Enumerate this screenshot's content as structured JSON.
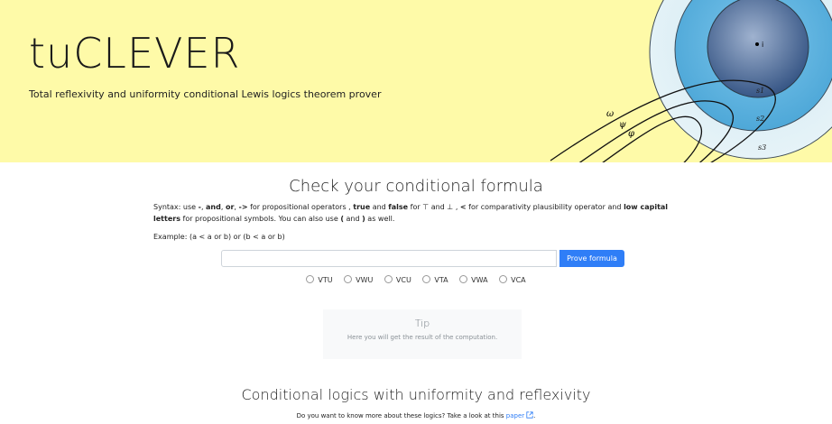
{
  "hero": {
    "title": "tuCLEVER",
    "subtitle": "Total reflexivity and uniformity conditional Lewis logics theorem prover",
    "diagram_labels": {
      "world": "i",
      "sphere1": "s1",
      "sphere2": "s2",
      "sphere3": "s3",
      "omega": "ω",
      "psi": "ψ",
      "phi": "φ"
    }
  },
  "check": {
    "title": "Check your conditional formula",
    "syntax": {
      "p1": "Syntax: use ",
      "k1": "-",
      "p2": ", ",
      "k2": "and",
      "p3": ", ",
      "k3": "or",
      "p4": ", ",
      "k4": "->",
      "p5": " for propositional operators , ",
      "k5": "true",
      "p6": " and ",
      "k6": "false",
      "p7": " for ⊤ and ⊥ , ",
      "k7": "<",
      "p8": " for comparativity plausibility operator and ",
      "k8": "low capital letters",
      "p9": " for propositional symbols. You can also use ",
      "k9": "(",
      "p10": " and ",
      "k10": ")",
      "p11": " as well."
    },
    "example": "Example: (a < a or b) or (b < a or b)",
    "input_value": "",
    "input_placeholder": "",
    "prove_label": "Prove formula",
    "logics": [
      "VTU",
      "VWU",
      "VCU",
      "VTA",
      "VWA",
      "VCA"
    ]
  },
  "tip": {
    "title": "Tip",
    "text": "Here you will get the result of the computation."
  },
  "info": {
    "title": "Conditional logics with uniformity and reflexivity",
    "text": "Do you want to know more about these logics? Take a look at this ",
    "link": "paper",
    "link_icon": "external-link-icon",
    "text_end": "."
  },
  "colors": {
    "hero_bg": "#fefaa8",
    "accent": "#2f7ef7",
    "sphere_inner": "#3a5a8c",
    "sphere_mid": "#5cb3e0",
    "sphere_outer": "#d6ecf5"
  }
}
